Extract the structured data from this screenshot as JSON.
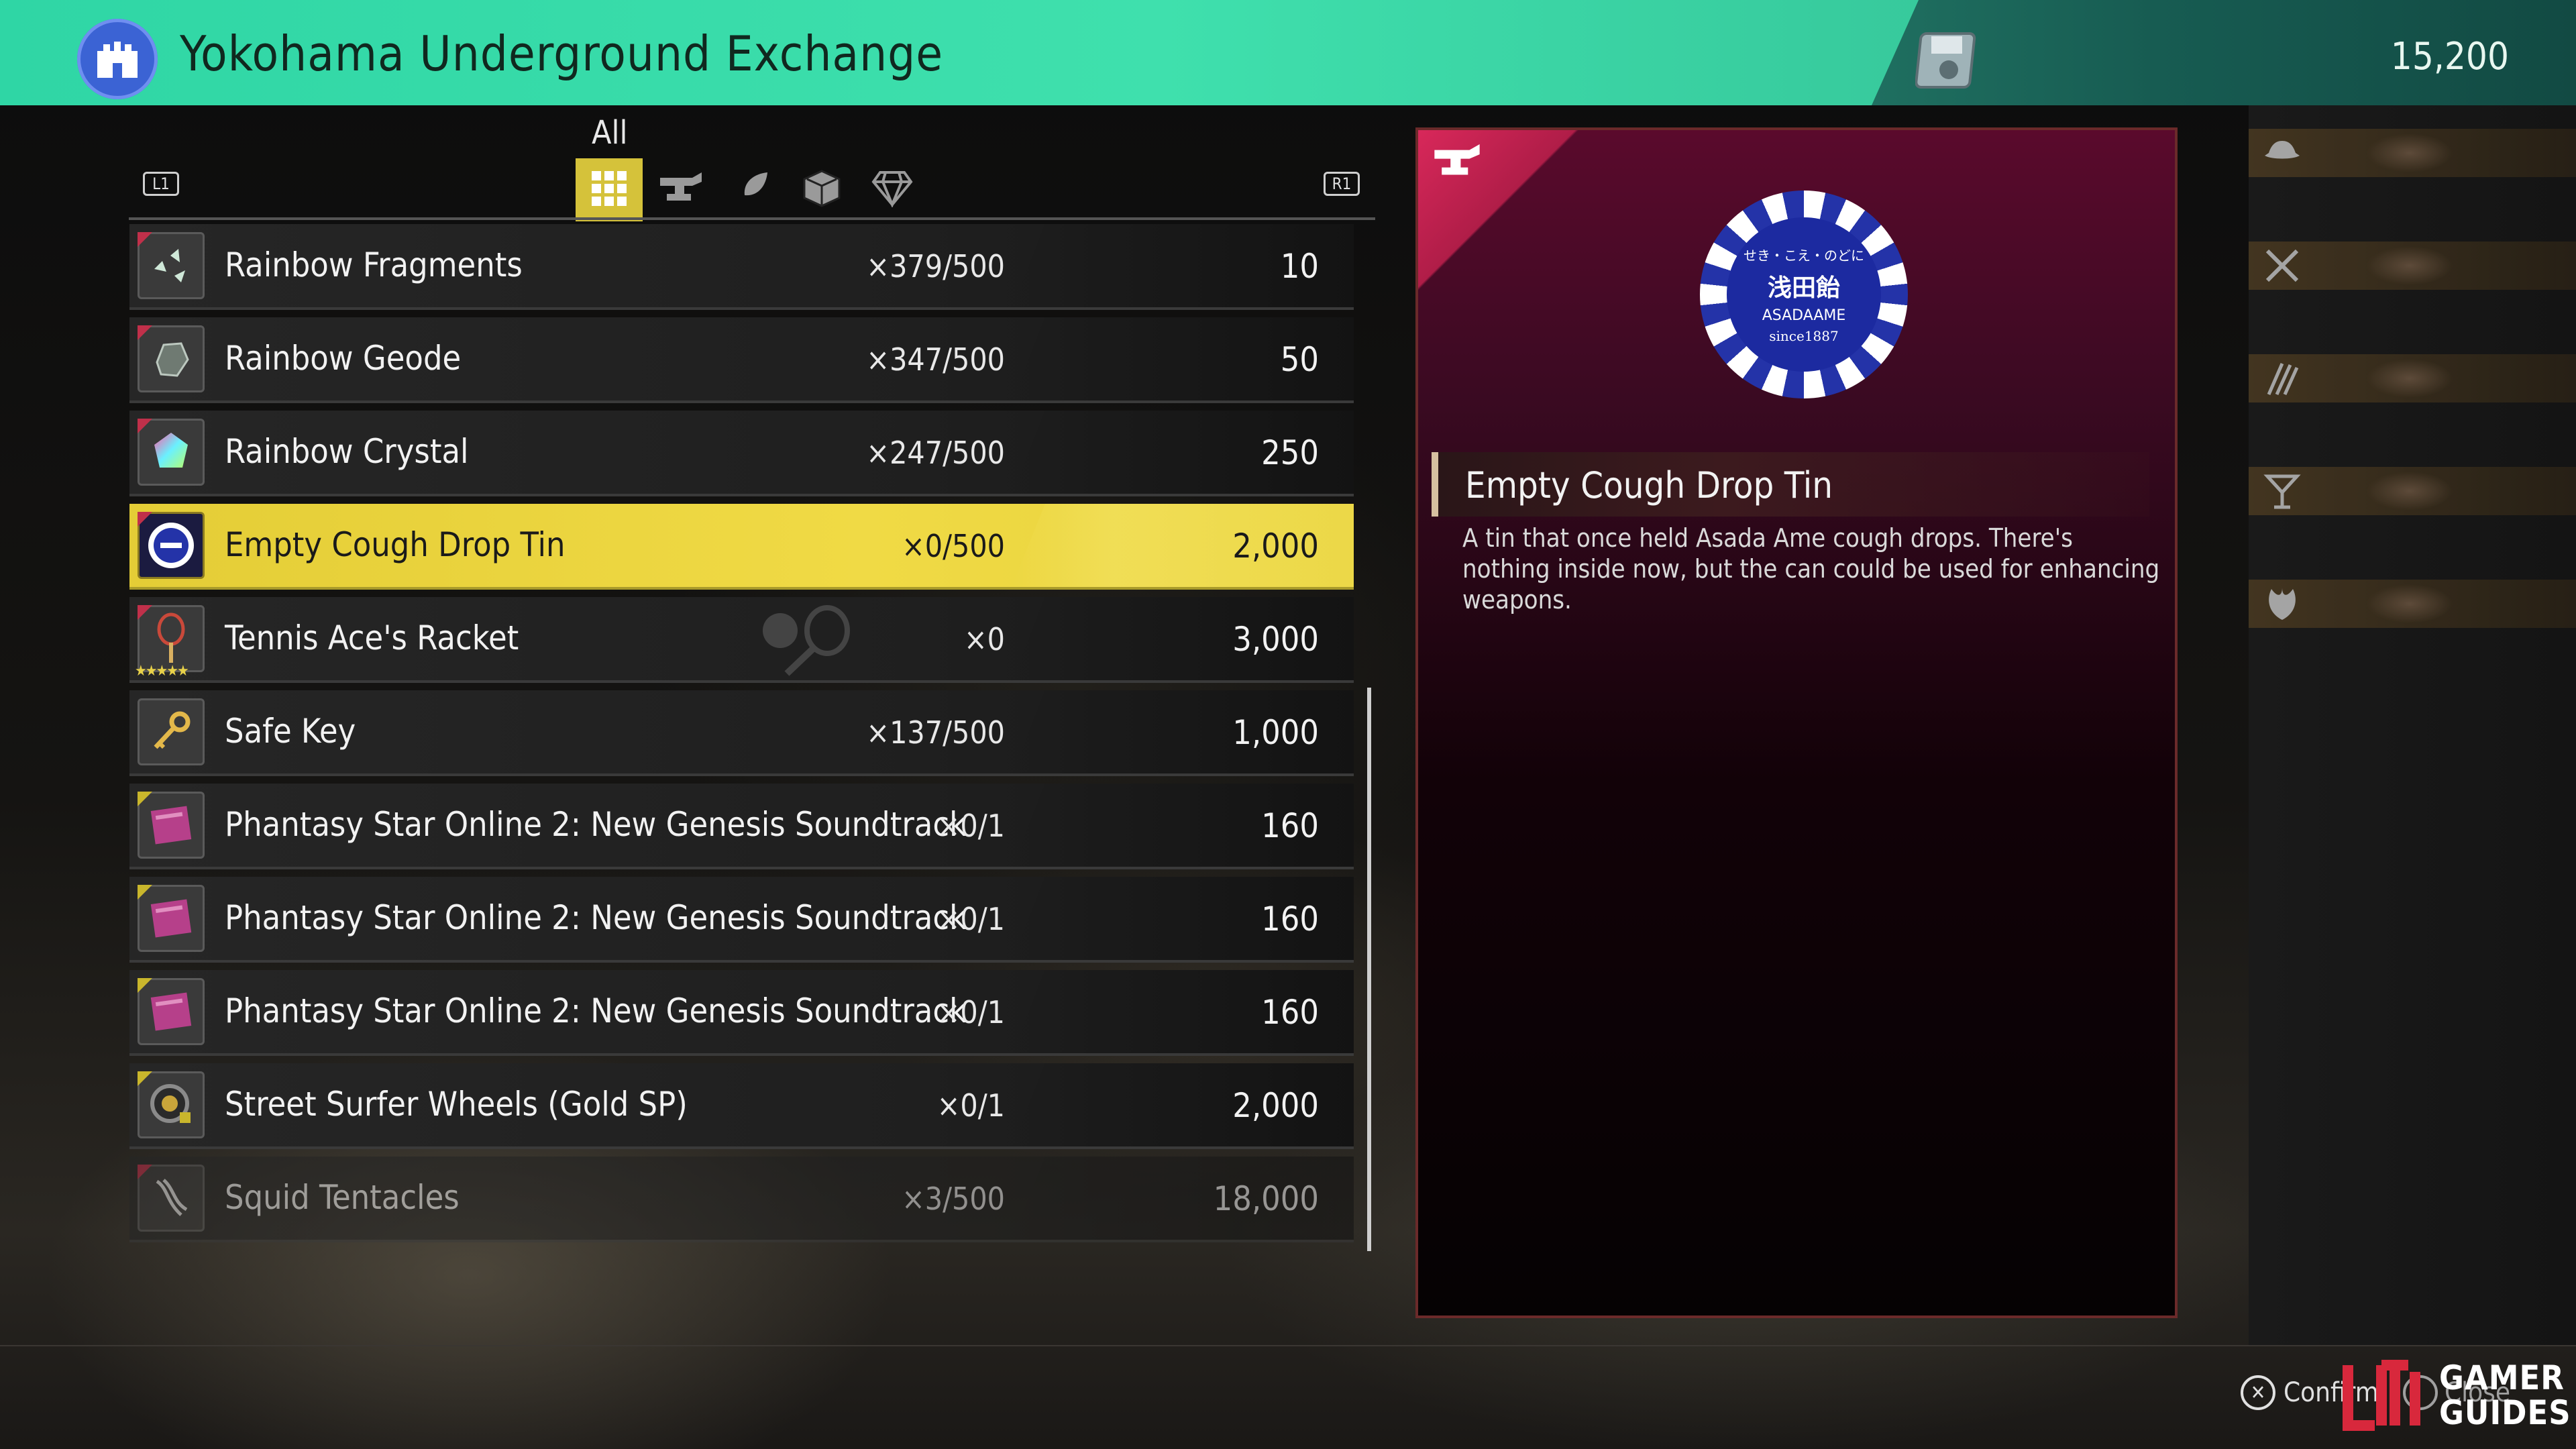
{
  "header": {
    "title": "Yokohama Underground Exchange",
    "money": "15,200"
  },
  "tabs": {
    "active_label": "All",
    "l1": "L1",
    "r1": "R1",
    "items": [
      {
        "icon": "grid-icon",
        "active": true
      },
      {
        "icon": "anvil-icon",
        "active": false
      },
      {
        "icon": "feather-icon",
        "active": false
      },
      {
        "icon": "box-icon",
        "active": false
      },
      {
        "icon": "gem-icon",
        "active": false
      }
    ]
  },
  "items": [
    {
      "name": "Rainbow Fragments",
      "qty": "×379/500",
      "price": "10",
      "icon": "fragments-icon"
    },
    {
      "name": "Rainbow Geode",
      "qty": "×347/500",
      "price": "50",
      "icon": "geode-icon"
    },
    {
      "name": "Rainbow Crystal",
      "qty": "×247/500",
      "price": "250",
      "icon": "crystal-icon"
    },
    {
      "name": "Empty Cough Drop Tin",
      "qty": "×0/500",
      "price": "2,000",
      "icon": "tin-icon"
    },
    {
      "name": "Tennis Ace's Racket",
      "qty": "×0",
      "price": "3,000",
      "icon": "racket-icon"
    },
    {
      "name": "Safe Key",
      "qty": "×137/500",
      "price": "1,000",
      "icon": "key-icon"
    },
    {
      "name": "Phantasy Star Online 2: New Genesis Soundtrack",
      "qty": "×0/1",
      "price": "160",
      "icon": "cd-icon"
    },
    {
      "name": "Phantasy Star Online 2: New Genesis Soundtrack",
      "qty": "×0/1",
      "price": "160",
      "icon": "cd-icon"
    },
    {
      "name": "Phantasy Star Online 2: New Genesis Soundtrack",
      "qty": "×0/1",
      "price": "160",
      "icon": "cd-icon"
    },
    {
      "name": "Street Surfer Wheels (Gold SP)",
      "qty": "×0/1",
      "price": "2,000",
      "icon": "wheel-icon"
    },
    {
      "name": "Squid Tentacles",
      "qty": "×3/500",
      "price": "18,000",
      "icon": "tentacles-icon"
    }
  ],
  "selected_index": 3,
  "racket_rating": "★★★★★",
  "detail": {
    "title": "Empty Cough Drop Tin",
    "description": "A tin that once held Asada Ame cough drops. There's nothing inside now, but the can could be used for enhancing weapons.",
    "badge": {
      "line1": "せき・こえ・のどに",
      "line2": "浅田飴",
      "line3": "ASADAAME",
      "line4": "since1887"
    }
  },
  "footer": {
    "confirm": "Confirm",
    "close": "Close",
    "watermark": "GAMER\nGUIDES"
  },
  "colors": {
    "header_accent": "#3fe0ad",
    "selected_row": "#f0da45",
    "detail_panel": "#5a0a2c"
  }
}
